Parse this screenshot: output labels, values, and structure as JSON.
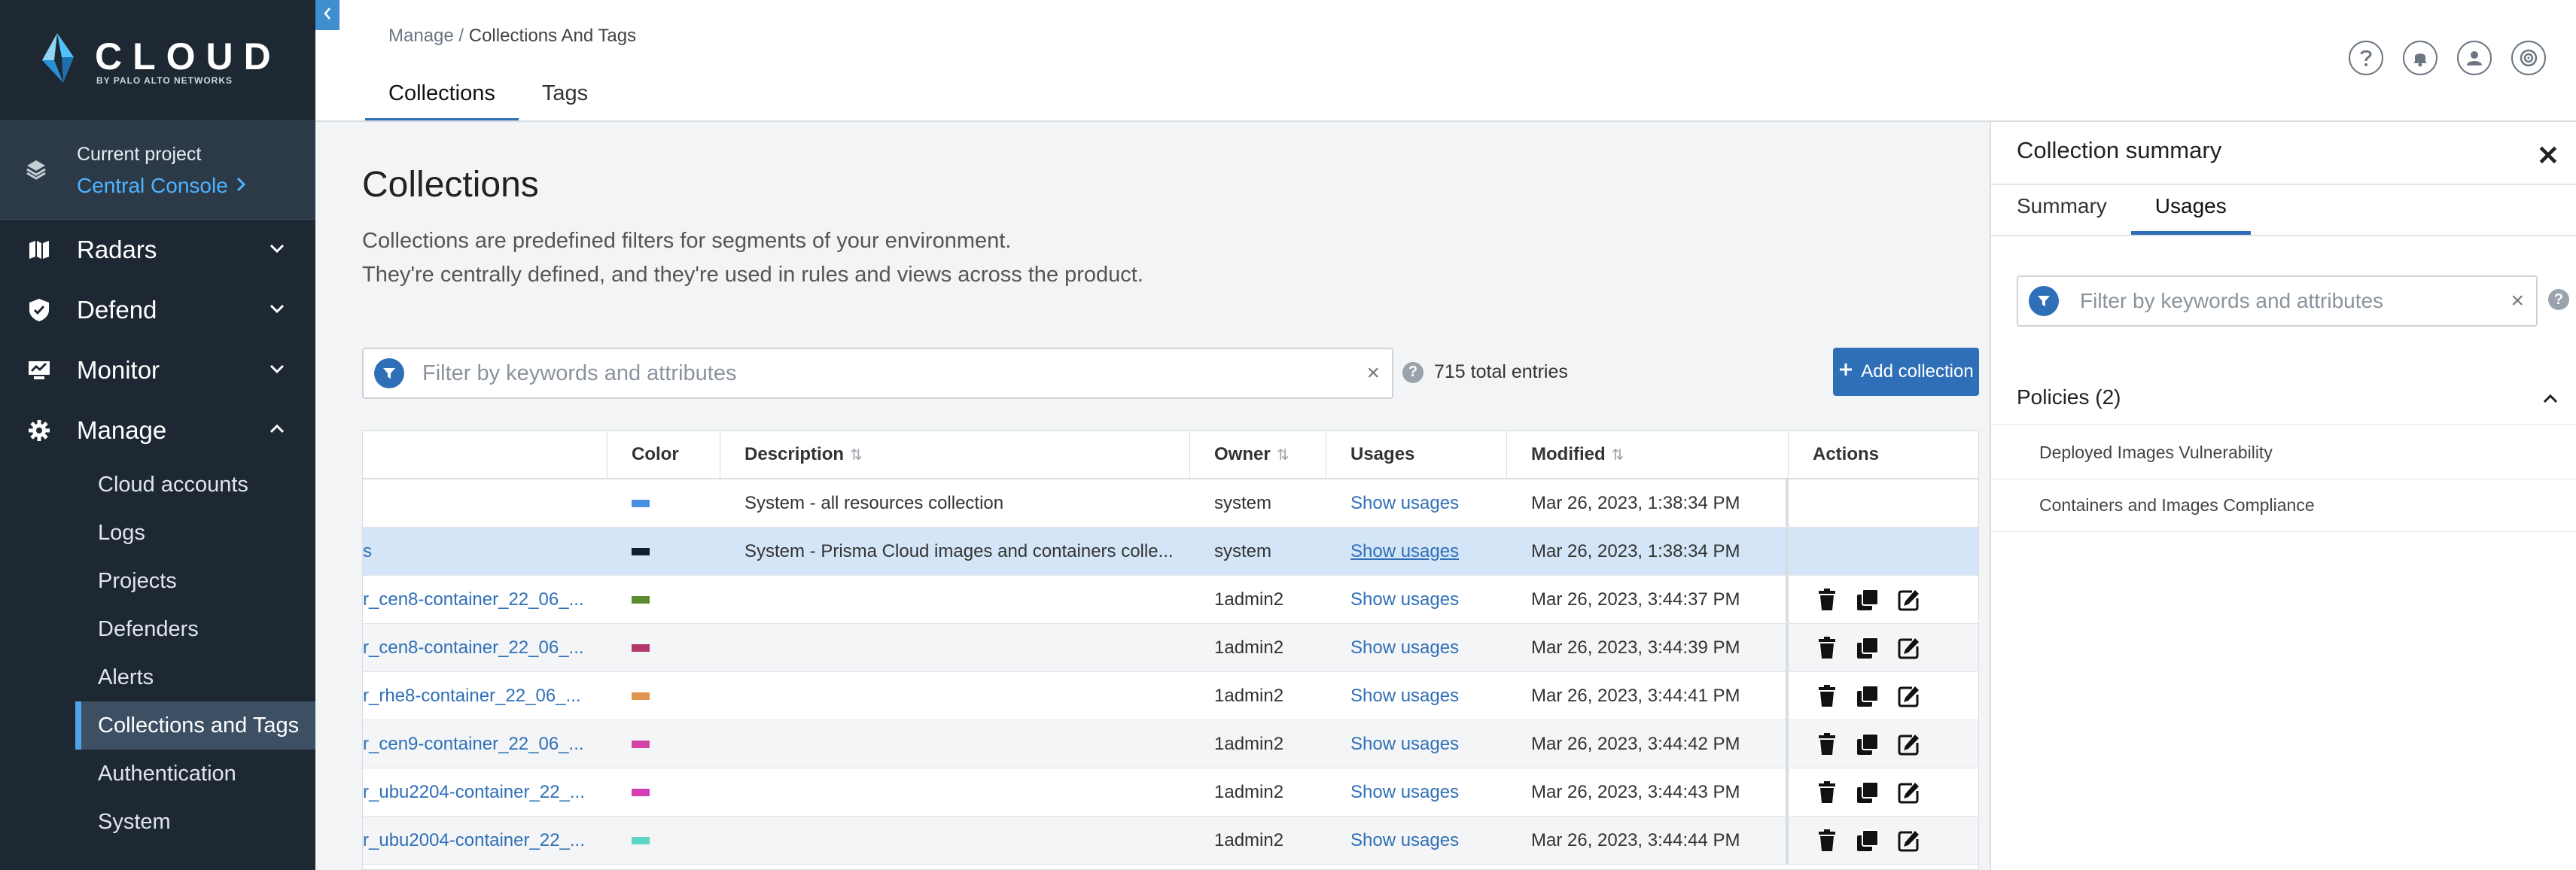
{
  "brand": {
    "word": "CLOUD",
    "sub": "BY PALO ALTO NETWORKS"
  },
  "project": {
    "label": "Current project",
    "name": "Central Console"
  },
  "nav": [
    {
      "label": "Radars",
      "icon": "map-icon"
    },
    {
      "label": "Defend",
      "icon": "shield-icon"
    },
    {
      "label": "Monitor",
      "icon": "monitor-icon"
    },
    {
      "label": "Manage",
      "icon": "gear-icon"
    }
  ],
  "manage_items": [
    "Cloud accounts",
    "Logs",
    "Projects",
    "Defenders",
    "Alerts",
    "Collections and Tags",
    "Authentication",
    "System"
  ],
  "breadcrumb": {
    "parent": "Manage",
    "separator": " / ",
    "current": "Collections And Tags"
  },
  "tabs": [
    "Collections",
    "Tags"
  ],
  "top_icons": [
    "help-icon",
    "bell-icon",
    "user-icon",
    "compass-icon"
  ],
  "page": {
    "title": "Collections",
    "desc_line1": "Collections are predefined filters for segments of your environment.",
    "desc_line2": "They're centrally defined, and they're used in rules and views across the product."
  },
  "filter": {
    "placeholder": "Filter by keywords and attributes",
    "clear": "×"
  },
  "entries": "715 total entries",
  "add_button": "Add collection",
  "table": {
    "headers": {
      "color": "Color",
      "description": "Description",
      "owner": "Owner",
      "usages": "Usages",
      "modified": "Modified",
      "actions": "Actions"
    },
    "rows": [
      {
        "name": "",
        "color": "#4a90e2",
        "description": "System - all resources collection",
        "owner": "system",
        "usages": "Show usages",
        "modified": "Mar 26, 2023, 1:38:34 PM"
      },
      {
        "name": "s",
        "color": "#111e2c",
        "description": "System - Prisma Cloud images and containers colle...",
        "owner": "system",
        "usages": "Show usages",
        "modified": "Mar 26, 2023, 1:38:34 PM"
      },
      {
        "name": "r_cen8-container_22_06_...",
        "color": "#5c8a2e",
        "description": "",
        "owner": "1admin2",
        "usages": "Show usages",
        "modified": "Mar 26, 2023, 3:44:37 PM"
      },
      {
        "name": "r_cen8-container_22_06_...",
        "color": "#b2376d",
        "description": "",
        "owner": "1admin2",
        "usages": "Show usages",
        "modified": "Mar 26, 2023, 3:44:39 PM"
      },
      {
        "name": "r_rhe8-container_22_06_...",
        "color": "#e0964e",
        "description": "",
        "owner": "1admin2",
        "usages": "Show usages",
        "modified": "Mar 26, 2023, 3:44:41 PM"
      },
      {
        "name": "r_cen9-container_22_06_...",
        "color": "#d445a6",
        "description": "",
        "owner": "1admin2",
        "usages": "Show usages",
        "modified": "Mar 26, 2023, 3:44:42 PM"
      },
      {
        "name": "r_ubu2204-container_22_...",
        "color": "#d63cb6",
        "description": "",
        "owner": "1admin2",
        "usages": "Show usages",
        "modified": "Mar 26, 2023, 3:44:43 PM"
      },
      {
        "name": "r_ubu2004-container_22_...",
        "color": "#5fd6c4",
        "description": "",
        "owner": "1admin2",
        "usages": "Show usages",
        "modified": "Mar 26, 2023, 3:44:44 PM"
      }
    ]
  },
  "panel": {
    "title": "Collection summary",
    "close": "✕",
    "tabs": [
      "Summary",
      "Usages"
    ],
    "filter_placeholder": "Filter by keywords and attributes",
    "policies_label": "Policies (2)",
    "policies": [
      "Deployed Images Vulnerability",
      "Containers and Images Compliance"
    ]
  },
  "colors": {
    "sidebar": "#1e2833",
    "accent": "#2f6fb8",
    "link": "#4fb3ff",
    "selected_row": "#d3e5f7"
  }
}
